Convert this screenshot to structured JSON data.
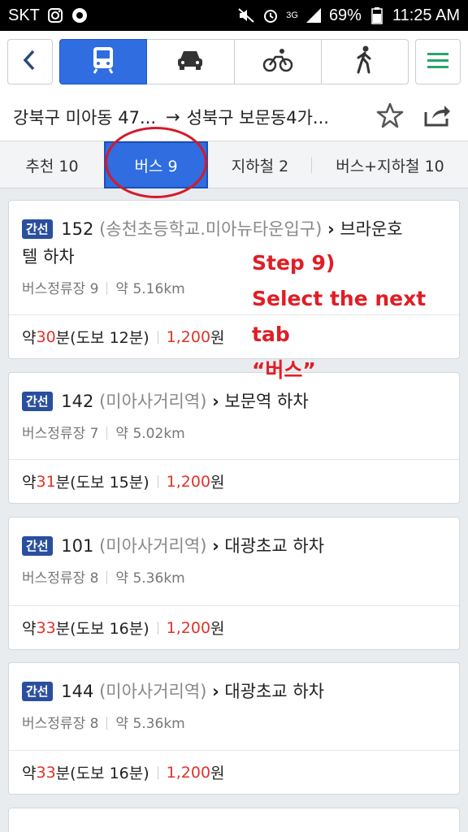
{
  "status": {
    "carrier": "SKT",
    "signal_badge": "3G",
    "battery": "69%",
    "time": "11:25 AM"
  },
  "modes": {
    "back_icon": "chevron-left-icon",
    "items": [
      "bus-icon",
      "car-icon",
      "bike-icon",
      "walk-icon"
    ],
    "active": 0,
    "menu_icon": "hamburger-menu-icon",
    "active_color": "#2f6de1",
    "menu_color": "#2aa56a"
  },
  "route": {
    "from": "강북구 미아동 47...",
    "arrow": "→",
    "to": "성북구 보문동4가..."
  },
  "tabs": [
    {
      "label": "추천 10"
    },
    {
      "label": "버스 9"
    },
    {
      "label": "지하철 2"
    },
    {
      "label": "버스+지하철 10"
    }
  ],
  "results": [
    {
      "badge": "간선",
      "bus": "152",
      "stop": "(송천초등학교.미아뉴타운입구)",
      "chevron": "›",
      "dest": "브라운호",
      "dest2": "텔 하차",
      "stops_label": "버스정류장 9",
      "distance": "약 5.16km",
      "time_prefix": "약 ",
      "minutes": "30",
      "time_suffix": "분(도보 12분)",
      "fare_num": "1,200",
      "fare_unit": "원"
    },
    {
      "badge": "간선",
      "bus": "142",
      "stop": "(미아사거리역)",
      "chevron": "›",
      "dest": "보문역 하차",
      "stops_label": "버스정류장 7",
      "distance": "약 5.02km",
      "time_prefix": "약 ",
      "minutes": "31",
      "time_suffix": "분(도보 15분)",
      "fare_num": "1,200",
      "fare_unit": "원"
    },
    {
      "badge": "간선",
      "bus": "101",
      "stop": "(미아사거리역)",
      "chevron": "›",
      "dest": "대광초교 하차",
      "stops_label": "버스정류장 8",
      "distance": "약 5.36km",
      "time_prefix": "약 ",
      "minutes": "33",
      "time_suffix": "분(도보 16분)",
      "fare_num": "1,200",
      "fare_unit": "원"
    },
    {
      "badge": "간선",
      "bus": "144",
      "stop": "(미아사거리역)",
      "chevron": "›",
      "dest": "대광초교 하차",
      "stops_label": "버스정류장 8",
      "distance": "약 5.36km",
      "time_prefix": "약 ",
      "minutes": "33",
      "time_suffix": "분(도보 16분)",
      "fare_num": "1,200",
      "fare_unit": "원"
    }
  ],
  "annotation": {
    "line1": "Step 9)",
    "line2": "Select the next tab",
    "line3": "“버스”"
  }
}
